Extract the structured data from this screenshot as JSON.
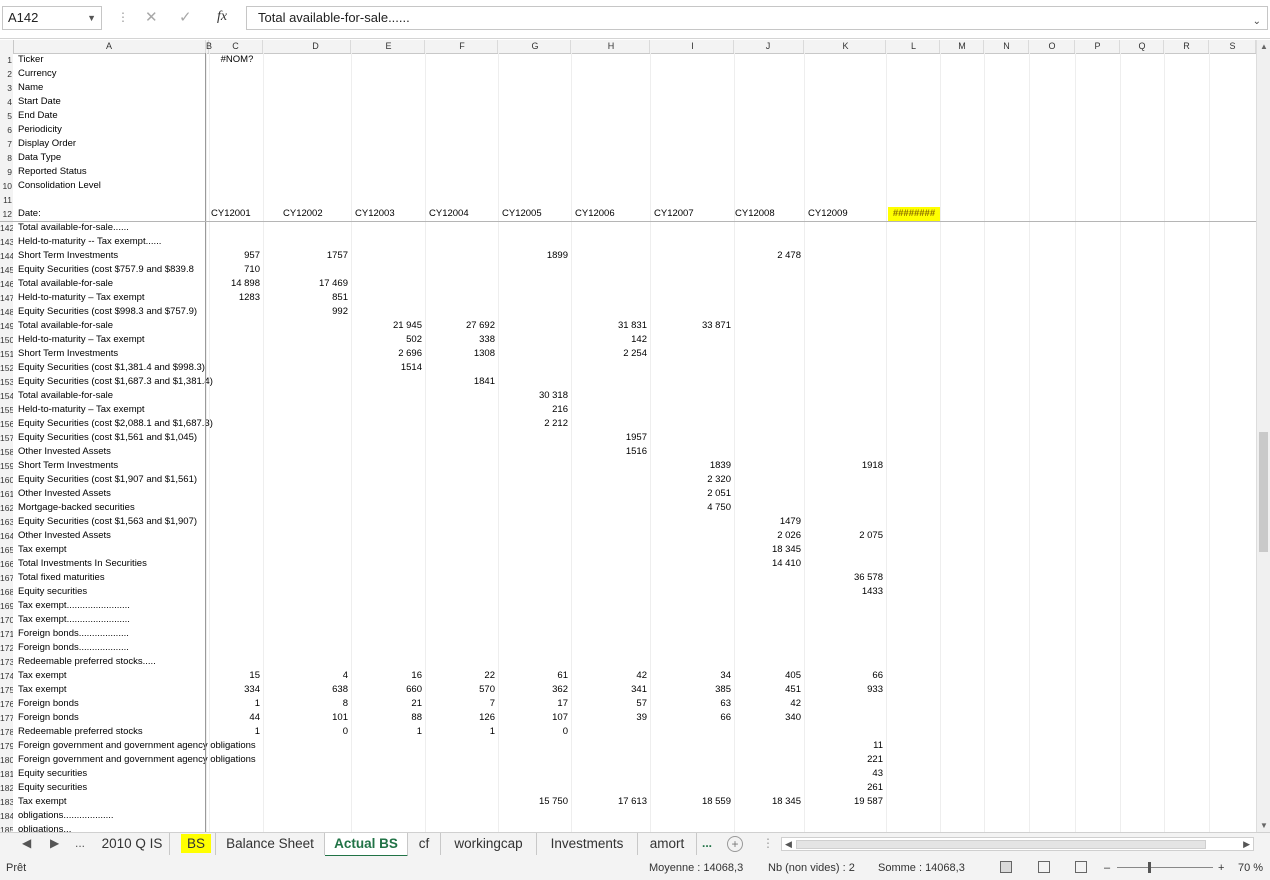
{
  "formula": {
    "name_box": "A142",
    "content": "Total available-for-sale......"
  },
  "columns": [
    "A",
    "B",
    "C",
    "D",
    "E",
    "F",
    "G",
    "H",
    "I",
    "J",
    "K",
    "L",
    "M",
    "N",
    "O",
    "P",
    "Q",
    "R",
    "S"
  ],
  "header_rows": [
    {
      "num": "1",
      "label": "Ticker",
      "c": "#NOM?"
    },
    {
      "num": "2",
      "label": "Currency"
    },
    {
      "num": "3",
      "label": "Name"
    },
    {
      "num": "4",
      "label": "Start Date"
    },
    {
      "num": "5",
      "label": "End Date"
    },
    {
      "num": "6",
      "label": "Periodicity"
    },
    {
      "num": "7",
      "label": "Display Order"
    },
    {
      "num": "8",
      "label": "Data Type"
    },
    {
      "num": "9",
      "label": "Reported Status"
    },
    {
      "num": "10",
      "label": "Consolidation Level"
    },
    {
      "num": "11",
      "label": ""
    },
    {
      "num": "12",
      "label": "Date:",
      "c": "CY12001",
      "d": "CY12002",
      "e": "CY12003",
      "f": "CY12004",
      "g": "CY12005",
      "h": "CY12006",
      "i": "CY12007",
      "j": "CY12008",
      "k": "CY12009",
      "l": "########"
    }
  ],
  "data_rows": [
    {
      "num": "142",
      "label": "Total available-for-sale......"
    },
    {
      "num": "143",
      "label": "Held-to-maturity -- Tax exempt......"
    },
    {
      "num": "144",
      "label": "Short Term Investments",
      "c": "957",
      "d": "1757",
      "g": "1899",
      "j": "2 478"
    },
    {
      "num": "145",
      "label": "Equity Securities (cost $757.9 and $839.8",
      "c": "710"
    },
    {
      "num": "146",
      "label": "Total available-for-sale",
      "c": "14 898",
      "d": "17 469"
    },
    {
      "num": "147",
      "label": "Held-to-maturity – Tax exempt",
      "c": "1283",
      "d": "851"
    },
    {
      "num": "148",
      "label": "Equity Securities (cost $998.3 and $757.9)",
      "d": "992"
    },
    {
      "num": "149",
      "label": "Total available-for-sale",
      "e": "21 945",
      "f": "27 692",
      "h": "31 831",
      "i": "33 871"
    },
    {
      "num": "150",
      "label": "Held-to-maturity – Tax exempt",
      "e": "502",
      "f": "338",
      "h": "142"
    },
    {
      "num": "151",
      "label": "Short Term Investments",
      "e": "2 696",
      "f": "1308",
      "h": "2 254"
    },
    {
      "num": "152",
      "label": "Equity Securities (cost $1,381.4 and $998.3)",
      "e": "1514"
    },
    {
      "num": "153",
      "label": "Equity Securities (cost $1,687.3 and $1,381.4)",
      "f": "1841"
    },
    {
      "num": "154",
      "label": "Total available-for-sale",
      "g": "30 318"
    },
    {
      "num": "155",
      "label": "Held-to-maturity – Tax exempt",
      "g": "216"
    },
    {
      "num": "156",
      "label": "Equity Securities (cost $2,088.1 and $1,687.3)",
      "g": "2 212"
    },
    {
      "num": "157",
      "label": "Equity Securities (cost $1,561 and $1,045)",
      "h": "1957"
    },
    {
      "num": "158",
      "label": "Other Invested Assets",
      "h": "1516"
    },
    {
      "num": "159",
      "label": "Short Term Investments",
      "i": "1839",
      "k": "1918"
    },
    {
      "num": "160",
      "label": "Equity Securities (cost $1,907 and $1,561)",
      "i": "2 320"
    },
    {
      "num": "161",
      "label": "Other Invested Assets",
      "i": "2 051"
    },
    {
      "num": "162",
      "label": "Mortgage-backed securities",
      "i": "4 750"
    },
    {
      "num": "163",
      "label": "Equity Securities (cost $1,563 and $1,907)",
      "j": "1479"
    },
    {
      "num": "164",
      "label": "Other Invested Assets",
      "j": "2 026",
      "k": "2 075"
    },
    {
      "num": "165",
      "label": "Tax exempt",
      "j": "18 345"
    },
    {
      "num": "166",
      "label": "Total Investments In Securities",
      "j": "14 410"
    },
    {
      "num": "167",
      "label": "Total fixed maturities",
      "k": "36 578"
    },
    {
      "num": "168",
      "label": "Equity securities",
      "k": "1433"
    },
    {
      "num": "169",
      "label": "Tax exempt........................"
    },
    {
      "num": "170",
      "label": "Tax exempt........................"
    },
    {
      "num": "171",
      "label": "Foreign bonds..................."
    },
    {
      "num": "172",
      "label": "Foreign bonds..................."
    },
    {
      "num": "173",
      "label": "Redeemable preferred stocks....."
    },
    {
      "num": "174",
      "label": "Tax exempt",
      "c": "15",
      "d": "4",
      "e": "16",
      "f": "22",
      "g": "61",
      "h": "42",
      "i": "34",
      "j": "405",
      "k": "66"
    },
    {
      "num": "175",
      "label": "Tax exempt",
      "c": "334",
      "d": "638",
      "e": "660",
      "f": "570",
      "g": "362",
      "h": "341",
      "i": "385",
      "j": "451",
      "k": "933"
    },
    {
      "num": "176",
      "label": "Foreign bonds",
      "c": "1",
      "d": "8",
      "e": "21",
      "f": "7",
      "g": "17",
      "h": "57",
      "i": "63",
      "j": "42"
    },
    {
      "num": "177",
      "label": "Foreign bonds",
      "c": "44",
      "d": "101",
      "e": "88",
      "f": "126",
      "g": "107",
      "h": "39",
      "i": "66",
      "j": "340"
    },
    {
      "num": "178",
      "label": "Redeemable preferred stocks",
      "c": "1",
      "d": "0",
      "e": "1",
      "f": "1",
      "g": "0"
    },
    {
      "num": "179",
      "label": "Foreign government and government agency obligations",
      "k": "11"
    },
    {
      "num": "180",
      "label": "Foreign government and government agency obligations",
      "k": "221"
    },
    {
      "num": "181",
      "label": "Equity securities",
      "k": "43"
    },
    {
      "num": "182",
      "label": "Equity securities",
      "k": "261"
    },
    {
      "num": "183",
      "label": "Tax exempt",
      "g": "15 750",
      "h": "17 613",
      "i": "18 559",
      "j": "18 345",
      "k": "19 587"
    },
    {
      "num": "184",
      "label": "obligations..................."
    },
    {
      "num": "185",
      "label": "obligations..."
    }
  ],
  "tabs": {
    "more": "...",
    "items": [
      "2010 Q IS",
      "BS",
      "Balance Sheet",
      "Actual BS",
      "cf",
      "workingcap",
      "Investments",
      "amort"
    ],
    "active": "Actual BS",
    "highlighted": "BS"
  },
  "status": {
    "ready": "Prêt",
    "average": "Moyenne : 14068,3",
    "count": "Nb (non vides) : 2",
    "sum": "Somme : 14068,3",
    "zoom": "70 %",
    "zoom_minus": "–",
    "zoom_plus": "+"
  }
}
